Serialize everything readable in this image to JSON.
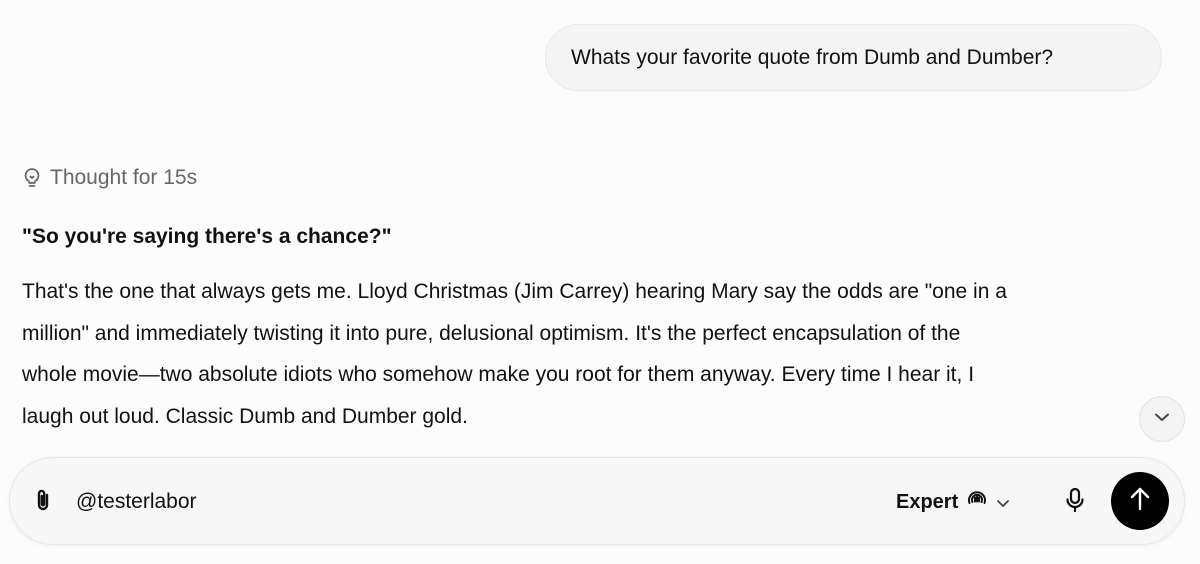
{
  "user_message": "Whats your favorite quote from Dumb and Dumber?",
  "thought": {
    "icon": "lightbulb-icon",
    "label": "Thought for 15s"
  },
  "response": {
    "quote": "\"So you're saying there's a chance?\"",
    "lines": [
      "That's the one that always gets me. Lloyd Christmas (Jim Carrey) hearing Mary say the odds are \"one in a",
      "million\" and immediately twisting it into pure, delusional optimism. It's the perfect encapsulation of the",
      "whole movie—two absolute idiots who somehow make you root for them anyway. Every time I hear it, I",
      "laugh out loud. Classic Dumb and Dumber gold."
    ]
  },
  "composer": {
    "value": "@testerlabor",
    "model_label": "Expert",
    "icons": {
      "attach": "paperclip-icon",
      "model": "expert-mode-icon",
      "dropdown": "chevron-down-icon",
      "mic": "microphone-icon",
      "send": "arrow-up-icon"
    }
  },
  "colors": {
    "send_button": "#000000",
    "composer_background": "#f7f7f7",
    "bubble_background": "#f4f4f4"
  }
}
